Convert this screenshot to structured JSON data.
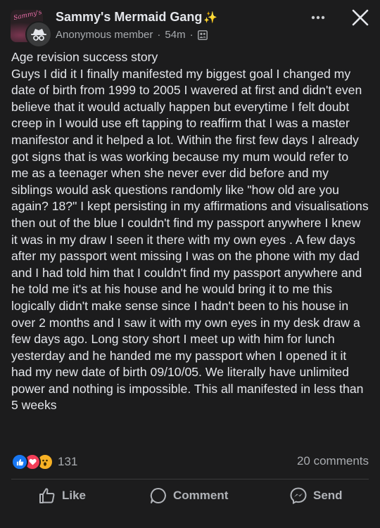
{
  "header": {
    "group_name": "Sammy's Mermaid Gang",
    "group_sparkle": "✨",
    "avatar_script_text": "Sammy's",
    "author": "Anonymous member",
    "separator": "·",
    "time": "54m",
    "separator2": "·"
  },
  "post": {
    "title": "Age revision success story",
    "body": "Guys I did it I finally manifested my biggest goal I changed my date of birth from 1999 to 2005 I wavered at first and didn't even believe that it would actually happen but everytime I felt doubt creep in I would use eft tapping to reaffirm that I was a master manifestor and it helped a lot. Within the first few days I already got signs that is was working because my mum would refer to me as a teenager when she never ever did before and my siblings would ask questions randomly like \"how old are you again? 18?\" I kept persisting in my affirmations and visualisations then out of the blue I couldn't find my passport anywhere I knew it was in my draw I seen it there with my own eyes . A few days after my passport went missing I was on the phone with my dad and I had told him that I couldn't find my passport anywhere and he told me it's at his house and he would bring it to me this logically didn't make sense since I hadn't been to his house in over 2 months and I saw it with my own eyes in my desk draw a few days ago. Long story short I meet up with him for lunch yesterday and he handed me my passport when I opened it it had my new date of birth 09/10/05. We literally have unlimited power and nothing is impossible. This all manifested in less than 5 weeks"
  },
  "stats": {
    "reaction_count": "131",
    "comments": "20 comments"
  },
  "actions": {
    "like": "Like",
    "comment": "Comment",
    "send": "Send"
  },
  "icons": {
    "more": "more-dots-icon",
    "close": "close-icon",
    "privacy": "group-members-icon",
    "anon": "anonymous-spy-icon"
  },
  "colors": {
    "background": "#1c1c1d",
    "like_blue": "#1877f2",
    "love_red": "#f33e58",
    "wow_yellow": "#f7b125"
  }
}
